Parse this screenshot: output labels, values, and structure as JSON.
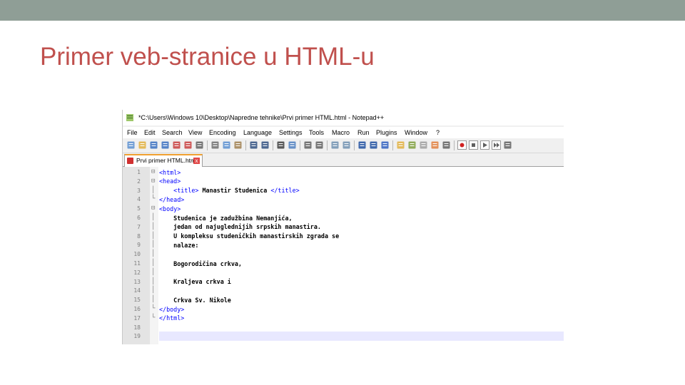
{
  "slide": {
    "title": "Primer veb-stranice u HTML-u"
  },
  "window": {
    "title": "*C:\\Users\\Windows 10\\Desktop\\Napredne tehnike\\Prvi primer HTML.html - Notepad++"
  },
  "menu": [
    "File",
    "Edit",
    "Search",
    "View",
    "Encoding",
    "Language",
    "Settings",
    "Tools",
    "Macro",
    "Run",
    "Plugins",
    "Window",
    "?"
  ],
  "toolbar_icons": [
    "new-file-icon",
    "open-file-icon",
    "save-icon",
    "save-all-icon",
    "close-icon",
    "close-all-icon",
    "print-icon",
    "cut-icon",
    "copy-icon",
    "paste-icon",
    "undo-icon",
    "redo-icon",
    "find-icon",
    "replace-icon",
    "zoom-in-icon",
    "zoom-out-icon",
    "sync-vertical-icon",
    "sync-horizontal-icon",
    "word-wrap-icon",
    "show-all-characters-icon",
    "indent-guide-icon",
    "udl-icon",
    "function-list-icon",
    "document-map-icon",
    "folder-workspace-icon",
    "monitoring-icon",
    "record-macro-icon",
    "stop-macro-icon",
    "play-macro-icon",
    "play-multiple-icon",
    "save-macro-icon"
  ],
  "tab": {
    "label": "Prvi primer HTML.html",
    "close": "x"
  },
  "colors": {
    "accent_bar": "#8f9e96",
    "title": "#c0504d",
    "tag": "#0000ff",
    "current_line": "#e8e8ff"
  },
  "code_lines": [
    {
      "n": "1",
      "fold": "open",
      "parts": [
        {
          "t": "tag",
          "v": "<html>"
        }
      ]
    },
    {
      "n": "2",
      "fold": "open",
      "parts": [
        {
          "t": "tag",
          "v": "<head>"
        }
      ]
    },
    {
      "n": "3",
      "fold": "line",
      "parts": [
        {
          "t": "ws",
          "v": "    "
        },
        {
          "t": "tag",
          "v": "<title>"
        },
        {
          "t": "txt",
          "v": " Manastir Studenica "
        },
        {
          "t": "tag",
          "v": "</title>"
        }
      ]
    },
    {
      "n": "4",
      "fold": "end",
      "parts": [
        {
          "t": "tag",
          "v": "</head>"
        }
      ]
    },
    {
      "n": "5",
      "fold": "open",
      "parts": [
        {
          "t": "tag",
          "v": "<body>"
        }
      ]
    },
    {
      "n": "6",
      "fold": "line",
      "parts": [
        {
          "t": "ws",
          "v": "    "
        },
        {
          "t": "txt",
          "v": "Studenica je zadužbina Nemanjića,"
        }
      ]
    },
    {
      "n": "7",
      "fold": "line",
      "parts": [
        {
          "t": "ws",
          "v": "    "
        },
        {
          "t": "txt",
          "v": "jedan od najuglednijih srpskih manastira."
        }
      ]
    },
    {
      "n": "8",
      "fold": "line",
      "parts": [
        {
          "t": "ws",
          "v": "    "
        },
        {
          "t": "txt",
          "v": "U kompleksu studeničkih manastirskih zgrada se"
        }
      ]
    },
    {
      "n": "9",
      "fold": "line",
      "parts": [
        {
          "t": "ws",
          "v": "    "
        },
        {
          "t": "txt",
          "v": "nalaze:"
        }
      ]
    },
    {
      "n": "10",
      "fold": "line",
      "parts": []
    },
    {
      "n": "11",
      "fold": "line",
      "parts": [
        {
          "t": "ws",
          "v": "    "
        },
        {
          "t": "txt",
          "v": "Bogorodičina crkva,"
        }
      ]
    },
    {
      "n": "12",
      "fold": "line",
      "parts": []
    },
    {
      "n": "13",
      "fold": "line",
      "parts": [
        {
          "t": "ws",
          "v": "    "
        },
        {
          "t": "txt",
          "v": "Kraljeva crkva i"
        }
      ]
    },
    {
      "n": "14",
      "fold": "line",
      "parts": []
    },
    {
      "n": "15",
      "fold": "line",
      "parts": [
        {
          "t": "ws",
          "v": "    "
        },
        {
          "t": "txt",
          "v": "Crkva Sv. Nikole"
        }
      ]
    },
    {
      "n": "16",
      "fold": "end",
      "parts": [
        {
          "t": "tag",
          "v": "</body>"
        }
      ]
    },
    {
      "n": "17",
      "fold": "end",
      "parts": [
        {
          "t": "tag",
          "v": "</html>"
        }
      ]
    },
    {
      "n": "18",
      "fold": "none",
      "parts": []
    },
    {
      "n": "19",
      "fold": "none",
      "parts": []
    }
  ],
  "current_line": "19"
}
